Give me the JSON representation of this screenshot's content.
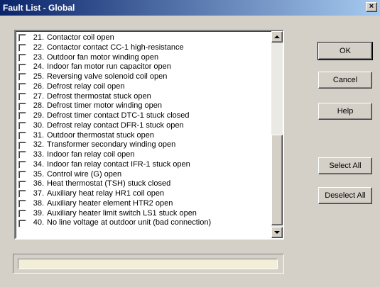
{
  "window": {
    "title": "Fault List - Global",
    "close_label": "×"
  },
  "fault_list": {
    "items": [
      {
        "num": "21.",
        "label": "Contactor coil open",
        "checked": false
      },
      {
        "num": "22.",
        "label": "Contactor contact CC-1 high-resistance",
        "checked": false
      },
      {
        "num": "23.",
        "label": "Outdoor fan motor winding open",
        "checked": false
      },
      {
        "num": "24.",
        "label": "Indoor fan motor run capacitor open",
        "checked": false
      },
      {
        "num": "25.",
        "label": "Reversing valve solenoid coil open",
        "checked": false
      },
      {
        "num": "26.",
        "label": "Defrost relay coil open",
        "checked": false
      },
      {
        "num": "27.",
        "label": "Defrost thermostat stuck open",
        "checked": false
      },
      {
        "num": "28.",
        "label": "Defrost timer motor winding open",
        "checked": false
      },
      {
        "num": "29.",
        "label": "Defrost timer contact DTC-1 stuck closed",
        "checked": false
      },
      {
        "num": "30.",
        "label": "Defrost relay contact DFR-1 stuck open",
        "checked": false
      },
      {
        "num": "31.",
        "label": "Outdoor thermostat stuck open",
        "checked": false
      },
      {
        "num": "32.",
        "label": "Transformer secondary winding open",
        "checked": false
      },
      {
        "num": "33.",
        "label": "Indoor fan relay coil open",
        "checked": false
      },
      {
        "num": "34.",
        "label": "Indoor fan relay contact IFR-1 stuck open",
        "checked": false
      },
      {
        "num": "35.",
        "label": "Control wire (G) open",
        "checked": false
      },
      {
        "num": "36.",
        "label": "Heat thermostat (TSH) stuck closed",
        "checked": false
      },
      {
        "num": "37.",
        "label": "Auxiliary heat relay HR1 coil open",
        "checked": false
      },
      {
        "num": "38.",
        "label": "Auxiliary heater element HTR2 open",
        "checked": false
      },
      {
        "num": "39.",
        "label": "Auxiliary heater limit switch LS1 stuck open",
        "checked": false
      },
      {
        "num": "40.",
        "label": "No line voltage at outdoor unit (bad connection)",
        "checked": false
      }
    ]
  },
  "buttons": {
    "ok": "OK",
    "cancel": "Cancel",
    "help": "Help",
    "select_all": "Select All",
    "deselect_all": "Deselect All"
  },
  "status": {
    "text": ""
  }
}
